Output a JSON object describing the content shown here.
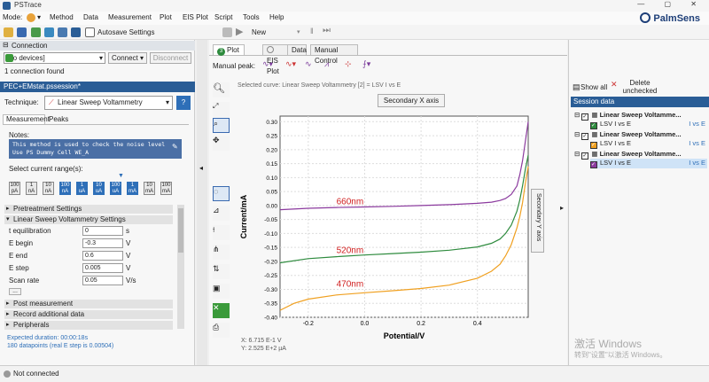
{
  "app": {
    "title": "PSTrace",
    "logo": "PalmSens"
  },
  "menu": {
    "mode_label": "Mode:",
    "items": [
      "Method",
      "Data",
      "Measurement",
      "Plot",
      "EIS Plot",
      "Script",
      "Tools",
      "Help"
    ]
  },
  "toolbar": {
    "autosave": "Autosave Settings",
    "new_label": "New"
  },
  "connection": {
    "header": "Connection",
    "device": "[no devices]",
    "connect": "Connect",
    "disconnect": "Disconnect",
    "status": "1 connection found"
  },
  "session_file": "PEC+EMstat.pssession*",
  "technique": {
    "label": "Technique:",
    "value": "Linear Sweep Voltammetry",
    "help": "?"
  },
  "method_tabs": [
    "Measurement",
    "Peaks"
  ],
  "notes": {
    "label": "Notes:",
    "text": "This method is used to check the noise level\nUse PS Dummy Cell WE_A"
  },
  "current_range": {
    "label": "Select current range(s):",
    "buttons": [
      {
        "top": "100",
        "bot": "pA",
        "on": false
      },
      {
        "top": "1",
        "bot": "nA",
        "on": false
      },
      {
        "top": "10",
        "bot": "nA",
        "on": false
      },
      {
        "top": "100",
        "bot": "nA",
        "on": true
      },
      {
        "top": "1",
        "bot": "uA",
        "on": true
      },
      {
        "top": "10",
        "bot": "uA",
        "on": true
      },
      {
        "top": "100",
        "bot": "uA",
        "on": true
      },
      {
        "top": "1",
        "bot": "mA",
        "on": true
      },
      {
        "top": "10",
        "bot": "mA",
        "on": false
      },
      {
        "top": "100",
        "bot": "mA",
        "on": false
      }
    ]
  },
  "groups": {
    "pretreatment": "Pretreatment Settings",
    "lsv": "Linear Sweep Voltammetry Settings",
    "post": "Post measurement",
    "record": "Record additional data",
    "peripherals": "Peripherals"
  },
  "params": [
    {
      "label": "t equilibration",
      "value": "0",
      "unit": "s"
    },
    {
      "label": "E begin",
      "value": "-0.3",
      "unit": "V"
    },
    {
      "label": "E end",
      "value": "0.6",
      "unit": "V"
    },
    {
      "label": "E step",
      "value": "0.005",
      "unit": "V"
    },
    {
      "label": "Scan rate",
      "value": "0.05",
      "unit": "V/s"
    }
  ],
  "more_button": "...",
  "expected": {
    "duration": "Expected duration: 00:00:18s",
    "datapoints": "180 datapoints (real E step is 0.00504)"
  },
  "status": {
    "text": "Not connected"
  },
  "plot_tabs": [
    {
      "label": "Plot",
      "badge": "3"
    },
    {
      "label": "EIS Plot"
    },
    {
      "label": "Data"
    },
    {
      "label": "Manual Control"
    }
  ],
  "plot_toolbar": {
    "manual_peak": "Manual peak:"
  },
  "plot": {
    "selected_curve": "Selected curve: Linear Sweep Voltammetry [2] = LSV I vs E",
    "secondary_x": "Secondary X axis",
    "secondary_y": "Secondary Y axis",
    "readout_x": "X: 6.715 E-1 V",
    "readout_y": "Y: 2.525 E+2 µA"
  },
  "chart_data": {
    "type": "line",
    "xlabel": "Potential/V",
    "ylabel": "Current/mA",
    "xlim": [
      -0.3,
      0.58
    ],
    "ylim": [
      -0.4,
      0.32
    ],
    "xticks": [
      "-0.2",
      "0.0",
      "0.2",
      "0.4"
    ],
    "yticks": [
      "0.30",
      "0.25",
      "0.20",
      "0.15",
      "0.10",
      "0.05",
      "0.00",
      "-0.05",
      "-0.10",
      "-0.15",
      "-0.20",
      "-0.25",
      "-0.30",
      "-0.35",
      "-0.40"
    ],
    "series": [
      {
        "name": "660nm",
        "color": "#8b3a9e",
        "x": [
          -0.3,
          -0.2,
          -0.1,
          0.0,
          0.1,
          0.2,
          0.3,
          0.4,
          0.45,
          0.48,
          0.5,
          0.52,
          0.54,
          0.55,
          0.56,
          0.57,
          0.58
        ],
        "y": [
          -0.015,
          -0.01,
          -0.007,
          -0.005,
          -0.003,
          0.0,
          0.003,
          0.008,
          0.012,
          0.018,
          0.025,
          0.04,
          0.07,
          0.11,
          0.16,
          0.23,
          0.3
        ]
      },
      {
        "name": "520nm",
        "color": "#2e8b3e",
        "x": [
          -0.3,
          -0.2,
          -0.1,
          0.0,
          0.1,
          0.2,
          0.3,
          0.4,
          0.45,
          0.48,
          0.5,
          0.52,
          0.54,
          0.55,
          0.56,
          0.57,
          0.58
        ],
        "y": [
          -0.205,
          -0.19,
          -0.183,
          -0.177,
          -0.172,
          -0.167,
          -0.16,
          -0.148,
          -0.135,
          -0.12,
          -0.1,
          -0.07,
          -0.02,
          0.02,
          0.07,
          0.13,
          0.18
        ]
      },
      {
        "name": "470nm",
        "color": "#f0a020",
        "x": [
          -0.3,
          -0.25,
          -0.2,
          -0.1,
          0.0,
          0.1,
          0.2,
          0.3,
          0.4,
          0.45,
          0.48,
          0.5,
          0.52,
          0.54,
          0.55,
          0.56,
          0.57,
          0.58
        ],
        "y": [
          -0.375,
          -0.35,
          -0.335,
          -0.32,
          -0.312,
          -0.305,
          -0.297,
          -0.285,
          -0.26,
          -0.235,
          -0.21,
          -0.18,
          -0.14,
          -0.08,
          -0.04,
          0.01,
          0.08,
          0.14
        ]
      }
    ]
  },
  "session": {
    "show_all": "Show all",
    "delete": "Delete unchecked",
    "header": "Session data",
    "items": [
      {
        "title": "Linear Sweep Voltamme...",
        "curve": "LSV I vs E",
        "axis": "I vs E",
        "color": "#2e8b3e"
      },
      {
        "title": "Linear Sweep Voltamme...",
        "curve": "LSV I vs E",
        "axis": "I vs E",
        "color": "#f0a020"
      },
      {
        "title": "Linear Sweep Voltamme...",
        "curve": "LSV I vs E",
        "axis": "I vs E",
        "color": "#8b3a9e"
      }
    ]
  },
  "watermark": {
    "line1": "激活 Windows",
    "line2": "转到\"设置\"以激活 Windows。"
  }
}
